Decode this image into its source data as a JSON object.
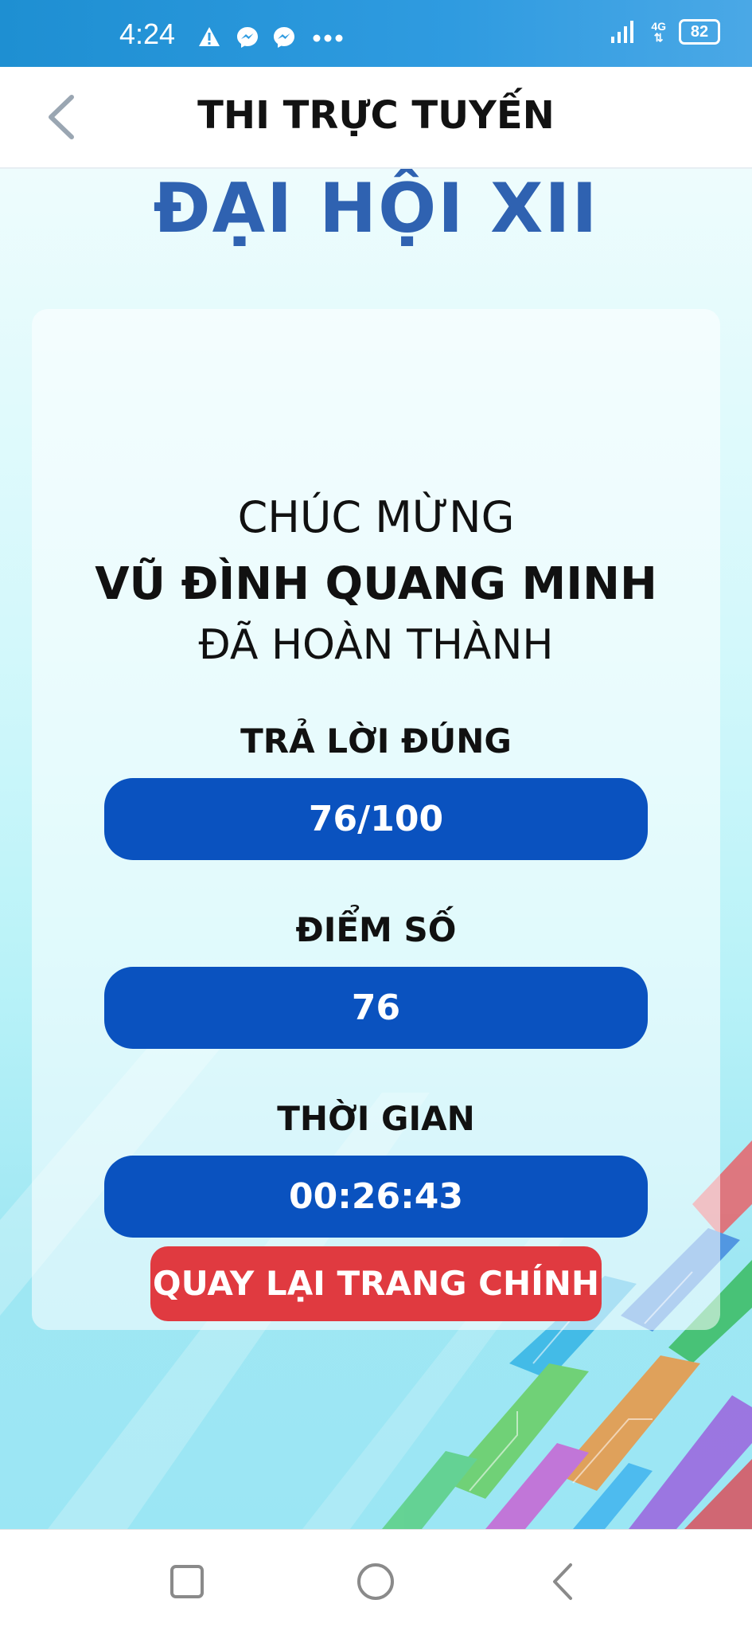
{
  "status_bar": {
    "time": "4:24",
    "network": "4G",
    "battery": "82",
    "icons": [
      "warning-icon",
      "messenger-icon",
      "messenger-icon",
      "more-dots-icon",
      "signal-icon",
      "battery-icon"
    ]
  },
  "header": {
    "title": "THI TRỰC TUYẾN",
    "back_icon": "chevron-left-icon"
  },
  "logo": {
    "title": "ĐẠI HỘI XII"
  },
  "result": {
    "congrats": "CHÚC MỪNG",
    "name": "VŨ ĐÌNH QUANG MINH",
    "completed": "ĐÃ HOÀN THÀNH",
    "correct_label": "TRẢ LỜI ĐÚNG",
    "correct_value": "76/100",
    "score_label": "ĐIỂM SỐ",
    "score_value": "76",
    "time_label": "THỜI GIAN",
    "time_value": "00:26:43"
  },
  "actions": {
    "home_button": "QUAY LẠI TRANG CHÍNH"
  },
  "nav_bar": {
    "icons": [
      "recent-apps-icon",
      "home-icon",
      "back-icon"
    ]
  },
  "colors": {
    "status_bar": "#2f9be0",
    "logo": "#2f62b1",
    "pill": "#0a52bf",
    "home_button": "#e03a40"
  }
}
